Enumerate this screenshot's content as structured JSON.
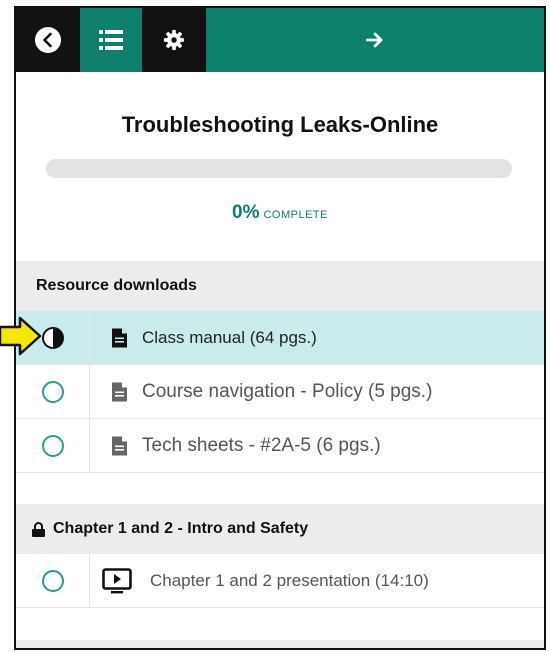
{
  "topbar": {
    "back_icon": "chevron-left-circle-icon",
    "list_icon": "list-icon",
    "settings_icon": "gear-icon",
    "next_icon": "arrow-right-icon",
    "accent_color": "#0c7f6d",
    "dark_color": "#111111"
  },
  "course": {
    "title": "Troubleshooting Leaks-Online",
    "progress_percent": 0,
    "progress_value": "0%",
    "progress_label": "COMPLETE"
  },
  "sections": [
    {
      "title": "Resource downloads",
      "locked": false,
      "items": [
        {
          "label": "Class manual (64 pgs.)",
          "icon": "document-icon",
          "status": "half",
          "active": true
        },
        {
          "label": "Course navigation - Policy (5 pgs.)",
          "icon": "document-icon",
          "status": "empty",
          "active": false
        },
        {
          "label": "Tech sheets - #2A-5 (6 pgs.)",
          "icon": "document-icon",
          "status": "empty",
          "active": false
        }
      ]
    },
    {
      "title": "Chapter 1 and 2 - Intro and Safety",
      "locked": true,
      "items": [
        {
          "label": "Chapter 1 and 2 presentation (14:10)",
          "icon": "video-play-icon",
          "status": "empty",
          "active": false
        }
      ]
    }
  ],
  "annotation": {
    "pointer_icon": "yellow-arrow-pointer-icon",
    "pointer_color": "#f5e800"
  }
}
